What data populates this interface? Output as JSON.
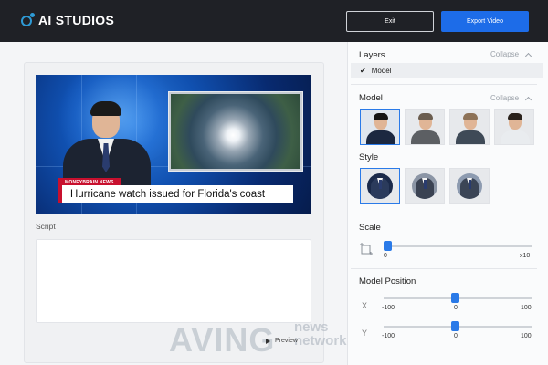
{
  "app": {
    "brand": "AI STUDIOS"
  },
  "toolbar": {
    "exit_label": "Exit",
    "export_label": "Export Video"
  },
  "editor": {
    "news_tag": "MONEYBRAIN NEWS",
    "headline": "Hurricane watch issued for Florida's coast",
    "script_label": "Script",
    "script_text": "",
    "preview_label": "Preview"
  },
  "watermark": {
    "main": "AVING",
    "sub_top": "news",
    "sub_bottom": "network"
  },
  "panel": {
    "layers": {
      "title": "Layers",
      "collapse_label": "Collapse",
      "items": [
        {
          "label": "Model",
          "checked": true
        }
      ]
    },
    "model": {
      "title": "Model",
      "collapse_label": "Collapse",
      "options": [
        {
          "name": "model-1",
          "selected": true,
          "hair": "#151515",
          "suit": "#1c2840"
        },
        {
          "name": "model-2",
          "selected": false,
          "hair": "#6b5d4f",
          "suit": "#5c5f63"
        },
        {
          "name": "model-3",
          "selected": false,
          "hair": "#8d7257",
          "suit": "#3f4a57"
        },
        {
          "name": "model-4",
          "selected": false,
          "hair": "#2a221c",
          "suit": "#e9ecef"
        }
      ]
    },
    "style": {
      "title": "Style",
      "options": [
        {
          "name": "style-1",
          "selected": true,
          "bg": "#1b2a4a",
          "suit": "#2b3b5c"
        },
        {
          "name": "style-2",
          "selected": false,
          "bg": "#8b95a5",
          "suit": "#3a4252"
        },
        {
          "name": "style-3",
          "selected": false,
          "bg": "#8d9bb0",
          "suit": "#3b4556"
        }
      ]
    },
    "scale": {
      "title": "Scale",
      "min_label": "0",
      "max_label": "x10",
      "value_fraction": 0.0
    },
    "position": {
      "title": "Model Position",
      "x": {
        "label": "X",
        "min": "-100",
        "mid": "0",
        "max": "100",
        "value": 0
      },
      "y": {
        "label": "Y",
        "min": "-100",
        "mid": "0",
        "max": "100",
        "value": 0
      }
    }
  },
  "colors": {
    "accent": "#1d6ce8",
    "topbar": "#1f2126",
    "news_red": "#c8102e"
  }
}
